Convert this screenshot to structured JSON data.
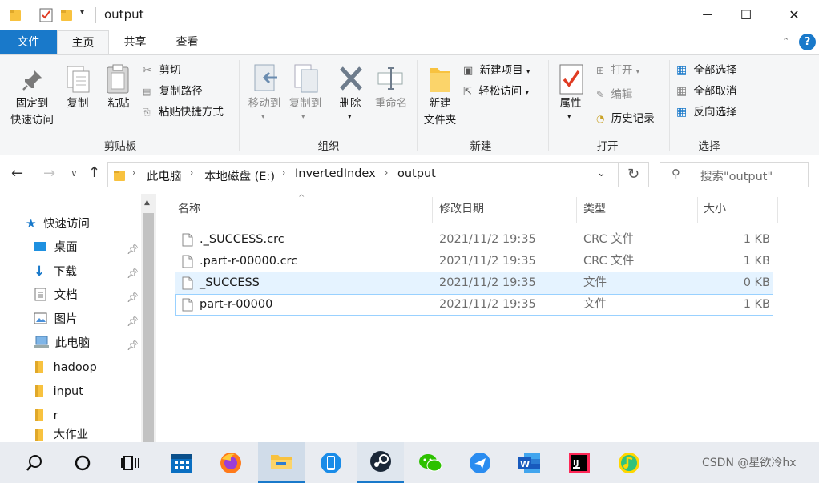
{
  "window": {
    "title": "output",
    "minimize_glyph": "—",
    "maximize_glyph": "☐",
    "close_glyph": "✕"
  },
  "tabs": [
    "文件",
    "主页",
    "共享",
    "查看"
  ],
  "help_glyph": "?",
  "ribbon": {
    "clipboard": {
      "pin_line1": "固定到",
      "pin_line2": "快速访问",
      "copy": "复制",
      "paste": "粘贴",
      "cut": "剪切",
      "copy_path": "复制路径",
      "paste_shortcut": "粘贴快捷方式",
      "label": "剪贴板"
    },
    "organize": {
      "move_to": "移动到",
      "copy_to": "复制到",
      "delete": "删除",
      "rename": "重命名",
      "label": "组织"
    },
    "new": {
      "new_folder_line1": "新建",
      "new_folder_line2": "文件夹",
      "new_item": "新建项目",
      "easy_access": "轻松访问",
      "label": "新建"
    },
    "open": {
      "properties": "属性",
      "open": "打开",
      "edit": "编辑",
      "history": "历史记录",
      "label": "打开"
    },
    "select": {
      "select_all": "全部选择",
      "select_none": "全部取消",
      "invert": "反向选择",
      "label": "选择"
    }
  },
  "address": {
    "crumbs": [
      "此电脑",
      "本地磁盘 (E:)",
      "InvertedIndex",
      "output"
    ],
    "search_placeholder": "搜索\"output\""
  },
  "nav": {
    "quick_access": "快速访问",
    "items": [
      {
        "label": "桌面",
        "pinned": true
      },
      {
        "label": "下载",
        "pinned": true
      },
      {
        "label": "文档",
        "pinned": true
      },
      {
        "label": "图片",
        "pinned": true
      },
      {
        "label": "此电脑",
        "pinned": true
      },
      {
        "label": "hadoop",
        "pinned": false
      },
      {
        "label": "input",
        "pinned": false
      },
      {
        "label": "r",
        "pinned": false
      },
      {
        "label": "大作业",
        "pinned": false
      }
    ]
  },
  "columns": {
    "name": "名称",
    "date": "修改日期",
    "type": "类型",
    "size": "大小"
  },
  "files": [
    {
      "name": "._SUCCESS.crc",
      "date": "2021/11/2 19:35",
      "type": "CRC 文件",
      "size": "1 KB",
      "state": "normal"
    },
    {
      "name": ".part-r-00000.crc",
      "date": "2021/11/2 19:35",
      "type": "CRC 文件",
      "size": "1 KB",
      "state": "normal"
    },
    {
      "name": "_SUCCESS",
      "date": "2021/11/2 19:35",
      "type": "文件",
      "size": "0 KB",
      "state": "hover"
    },
    {
      "name": "part-r-00000",
      "date": "2021/11/2 19:35",
      "type": "文件",
      "size": "1 KB",
      "state": "focused"
    }
  ],
  "taskbar": {
    "apps": [
      "search",
      "task-view",
      "widgets",
      "calendar",
      "firefox",
      "file-explorer",
      "phone",
      "steam",
      "wechat",
      "feishu",
      "word",
      "intellij",
      "qqmusic"
    ]
  },
  "watermark": "CSDN @星欲冷hx",
  "colors": {
    "accent": "#1979ca",
    "hover_row": "#e5f3ff",
    "focus_border": "#99d1ff",
    "folder": "#f8c23f"
  }
}
